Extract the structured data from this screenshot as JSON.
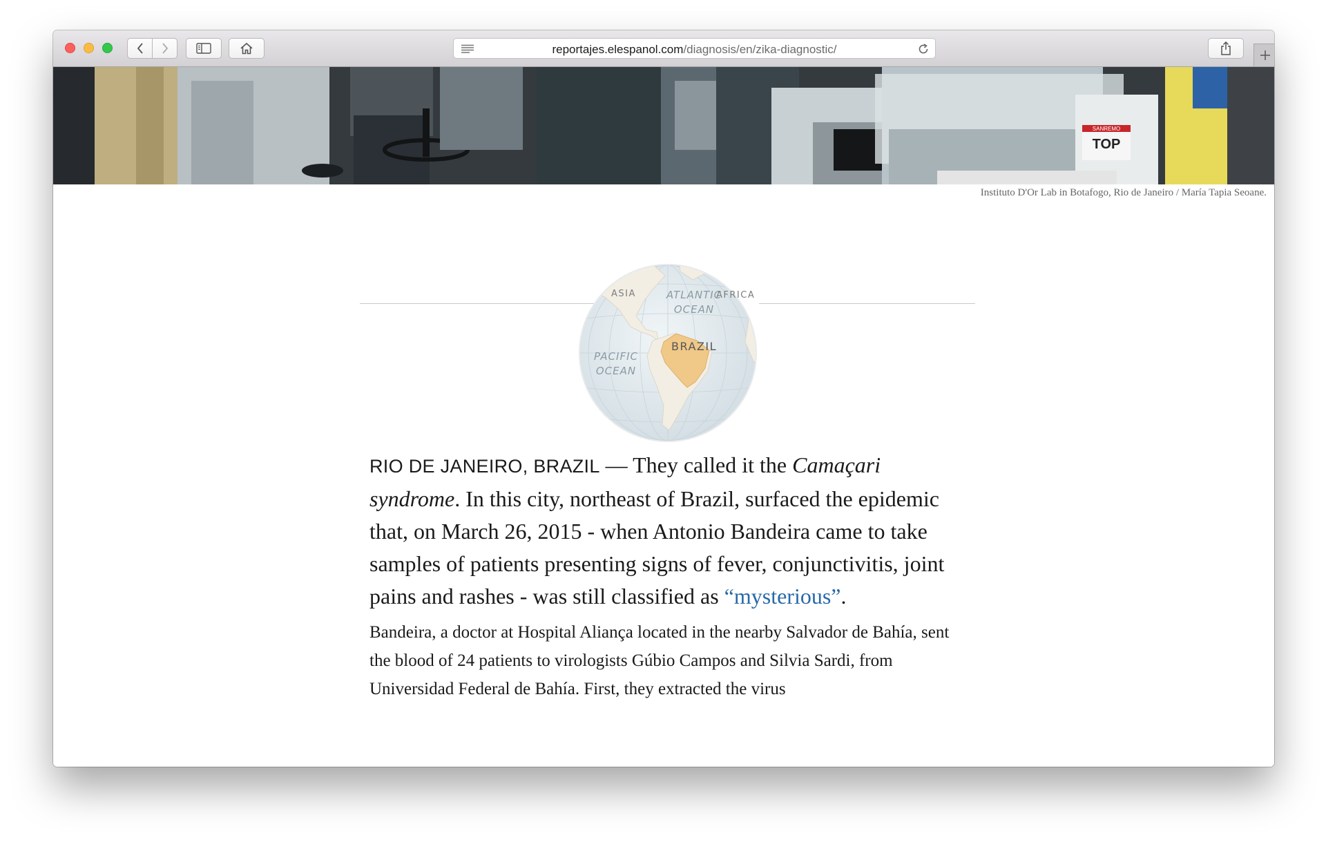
{
  "browser": {
    "url_domain": "reportajes.elespanol.com",
    "url_path": "/diagnosis/en/zika-diagnostic/",
    "icons": [
      "back-icon",
      "forward-icon",
      "sidebar-icon",
      "home-icon",
      "reader-icon",
      "reload-icon",
      "share-icon",
      "plus-icon"
    ]
  },
  "hero": {
    "caption": "Instituto D'Or Lab in Botafogo, Rio de Janeiro / María Tapia Seoane.",
    "label_top": "TOP",
    "label_small": "SANREMO"
  },
  "globe": {
    "label_atlantic_1": "ATLANTIC",
    "label_atlantic_2": "OCEAN",
    "label_asia": "ASIA",
    "label_africa": "AFRICA",
    "label_brazil": "BRAZIL",
    "label_pacific_1": "PACIFIC",
    "label_pacific_2": "OCEAN",
    "highlight_color": "#f0c888"
  },
  "article": {
    "dateline": "RIO DE JANEIRO, BRAZIL",
    "lead_part1": " — They called it the ",
    "lead_italic_1": "Camaçari syndrome",
    "lead_part2": ". In this city, northeast of Brazil, surfaced the epidemic that, on March 26, 2015 - when Antonio Bandeira came to take samples of patients presenting signs of fever, conjunctivitis, joint pains and rashes - was still classified as ",
    "lead_link": "“mysterious”",
    "lead_part3": ".",
    "para2": "Bandeira, a doctor at Hospital Aliança located in the nearby Salvador de Bahía, sent the blood of 24 patients to virologists Gúbio Campos and Silvia Sardi, from Universidad Federal de Bahía. First, they extracted the virus",
    "link_color": "#2869a8"
  }
}
